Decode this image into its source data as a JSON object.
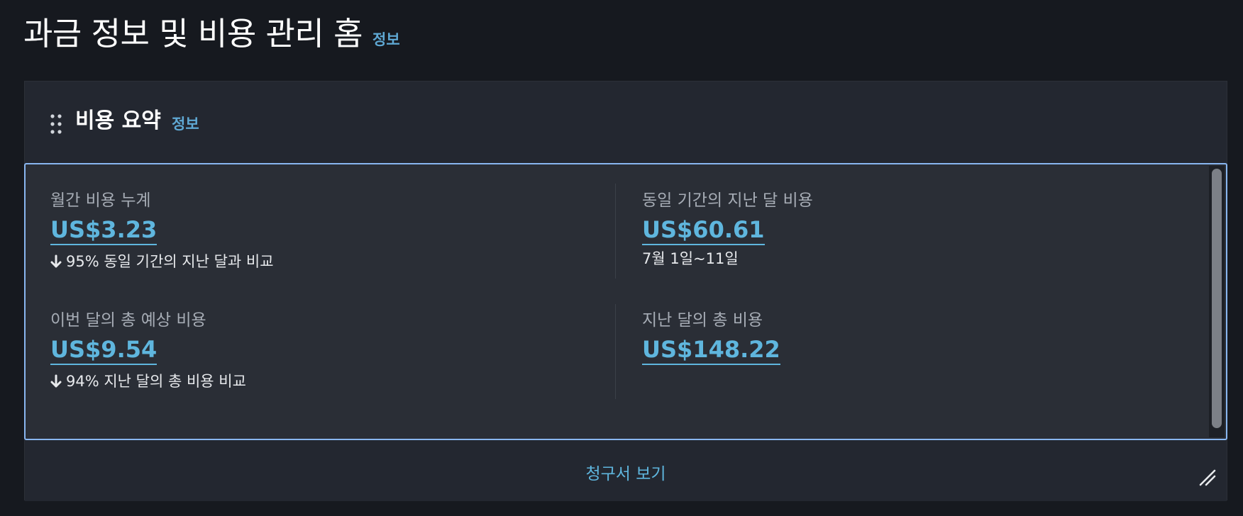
{
  "page": {
    "title": "과금 정보 및 비용 관리 홈",
    "info_label": "정보"
  },
  "widget": {
    "title": "비용 요약",
    "info_label": "정보",
    "metrics": [
      {
        "label": "월간 비용 누계",
        "value": "US$3.23",
        "sub": "95% 동일 기간의 지난 달과 비교",
        "trend": "down"
      },
      {
        "label": "동일 기간의 지난 달 비용",
        "value": "US$60.61",
        "sub": "7월 1일~11일"
      },
      {
        "label": "이번 달의 총 예상 비용",
        "value": "US$9.54",
        "sub": "94% 지난 달의 총 비용 비교",
        "trend": "down"
      },
      {
        "label": "지난 달의 총 비용",
        "value": "US$148.22"
      }
    ],
    "footer_link": "청구서 보기"
  },
  "colors": {
    "background": "#16191f",
    "panel": "#232730",
    "accent_link": "#5fb6de",
    "focus_border": "#89b6f0"
  },
  "icons": {
    "drag": "drag-handle-icon",
    "trend_down": "arrow-down-icon",
    "resize": "resize-handle-icon"
  }
}
